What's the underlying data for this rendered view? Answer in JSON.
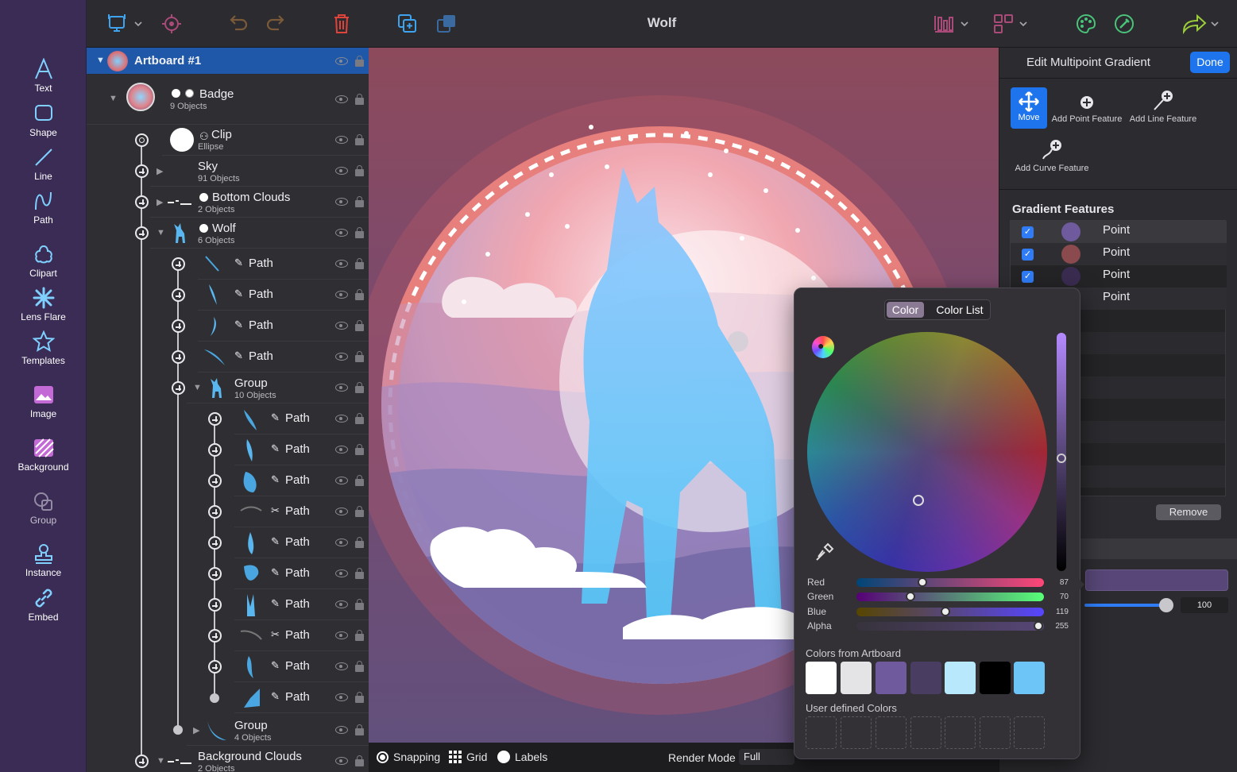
{
  "window": {
    "title": "Wolf"
  },
  "tools": [
    {
      "label": "Text",
      "icon": "text-tool-icon"
    },
    {
      "label": "Shape",
      "icon": "shape-tool-icon"
    },
    {
      "label": "Line",
      "icon": "line-tool-icon"
    },
    {
      "label": "Path",
      "icon": "path-tool-icon"
    },
    {
      "label": "Clipart",
      "icon": "clipart-icon"
    },
    {
      "label": "Lens Flare",
      "icon": "lens-flare-icon"
    },
    {
      "label": "Templates",
      "icon": "templates-icon"
    },
    {
      "label": "Image",
      "icon": "image-icon"
    },
    {
      "label": "Background",
      "icon": "background-icon"
    },
    {
      "label": "Group",
      "icon": "group-icon"
    },
    {
      "label": "Instance",
      "icon": "instance-icon"
    },
    {
      "label": "Embed",
      "icon": "embed-icon"
    }
  ],
  "layers": {
    "artboard": "Artboard #1",
    "badge": {
      "name": "Badge",
      "sub": "9 Objects"
    },
    "clip": {
      "name": "Clip",
      "sub": "Ellipse"
    },
    "sky": {
      "name": "Sky",
      "sub": "91 Objects"
    },
    "bottom_clouds": {
      "name": "Bottom Clouds",
      "sub": "2 Objects"
    },
    "wolf": {
      "name": "Wolf",
      "sub": "6 Objects"
    },
    "path_label": "Path",
    "group1": {
      "name": "Group",
      "sub": "10 Objects"
    },
    "group2": {
      "name": "Group",
      "sub": "4 Objects"
    },
    "bg_clouds": {
      "name": "Background Clouds",
      "sub": "2 Objects"
    }
  },
  "status": {
    "snapping": "Snapping",
    "grid": "Grid",
    "labels": "Labels",
    "render_mode_label": "Render Mode",
    "render_mode_value": "Full"
  },
  "gradient_panel": {
    "title": "Edit Multipoint Gradient",
    "done": "Done",
    "features": {
      "move": "Move",
      "add_point": "Add Point Feature",
      "add_line": "Add Line Feature",
      "add_curve": "Add Curve Feature"
    },
    "section_title": "Gradient Features",
    "rows": [
      {
        "label": "Point",
        "color": "#6e5a9c"
      },
      {
        "label": "Point",
        "color": "#8a4a4e"
      },
      {
        "label": "Point",
        "color": "#3a2c50"
      },
      {
        "label": "Point",
        "color": "#574677"
      }
    ],
    "remove": "Remove",
    "opacity_value": "100",
    "current_color": "#574677"
  },
  "color_picker": {
    "tab_color": "Color",
    "tab_color_list": "Color List",
    "channels": [
      {
        "label": "Red",
        "value": "87"
      },
      {
        "label": "Green",
        "value": "70"
      },
      {
        "label": "Blue",
        "value": "119"
      },
      {
        "label": "Alpha",
        "value": "255"
      }
    ],
    "artboard_colors_title": "Colors from Artboard",
    "artboard_colors": [
      "#ffffff",
      "#e4e4e6",
      "#6e5a9c",
      "#4a3d62",
      "#b8e8fb",
      "#000000",
      "#6cc4f7"
    ],
    "user_colors_title": "User defined Colors"
  }
}
